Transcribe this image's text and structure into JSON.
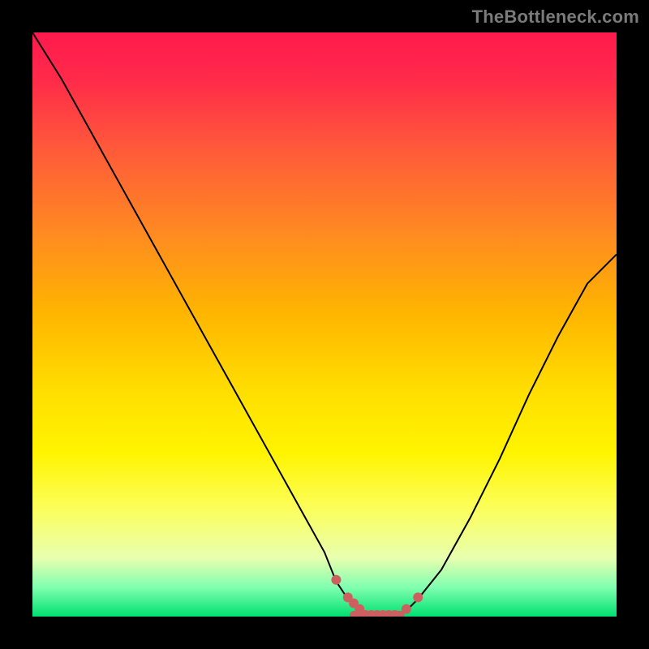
{
  "watermark": "TheBottleneck.com",
  "chart_data": {
    "type": "line",
    "title": "",
    "xlabel": "",
    "ylabel": "",
    "xlim": [
      0,
      100
    ],
    "ylim": [
      0,
      100
    ],
    "series": [
      {
        "name": "bottleneck-curve",
        "x": [
          0,
          5,
          10,
          15,
          20,
          25,
          30,
          35,
          40,
          45,
          50,
          52,
          54,
          56,
          58,
          60,
          62,
          64,
          66,
          70,
          75,
          80,
          85,
          90,
          95,
          100
        ],
        "y": [
          100,
          92,
          83,
          74,
          65,
          56,
          47,
          38,
          29,
          20,
          11,
          6,
          3,
          1,
          0,
          0,
          0,
          1,
          3,
          8,
          17,
          27,
          38,
          48,
          57,
          62
        ]
      }
    ],
    "markers": {
      "name": "optimal-range-dots",
      "x": [
        52,
        54,
        55,
        56,
        57,
        58,
        59,
        60,
        61,
        62,
        64,
        66
      ],
      "y": [
        6,
        3,
        2,
        1,
        0,
        0,
        0,
        0,
        0,
        0,
        1,
        3
      ]
    },
    "flat_segment": {
      "x0": 55,
      "x1": 63,
      "y": 0
    }
  }
}
